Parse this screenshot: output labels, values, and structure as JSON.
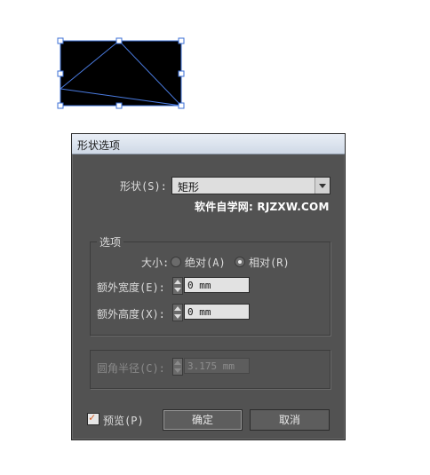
{
  "dialog": {
    "title": "形状选项",
    "shape_label": "形状(S):",
    "shape_value": "矩形",
    "watermark": "软件自学网: RJZXW.COM",
    "options_group_title": "选项",
    "size_label": "大小:",
    "radio_absolute": "绝对(A)",
    "radio_relative": "相对(R)",
    "extra_width_label": "额外宽度(E):",
    "extra_width_value": "0 mm",
    "extra_height_label": "额外高度(X):",
    "extra_height_value": "0 mm",
    "corner_radius_label": "圆角半径(C):",
    "corner_radius_value": "3.175 mm",
    "preview_label": "预览(P)",
    "ok_label": "确定",
    "cancel_label": "取消"
  },
  "colors": {
    "dialog_bg": "#525252",
    "selection": "#3b6fd6",
    "shape_fill": "#000000",
    "checkmark": "#d65a1e"
  }
}
